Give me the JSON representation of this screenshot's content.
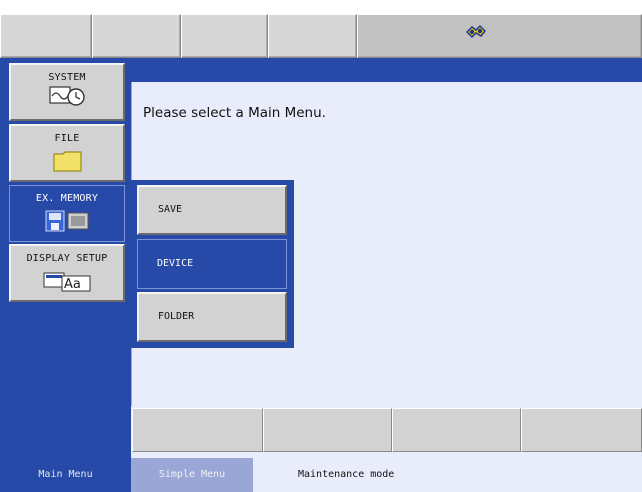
{
  "top_bar": {
    "status_icon": "robot-servo-icon"
  },
  "left_menu": {
    "items": [
      {
        "label": "SYSTEM",
        "icon": "system-clock-icon"
      },
      {
        "label": "FILE",
        "icon": "folder-icon"
      },
      {
        "label": "EX. MEMORY",
        "icon": "memory-device-icon"
      },
      {
        "label": "DISPLAY SETUP",
        "icon": "display-setup-icon"
      }
    ]
  },
  "main": {
    "message": "Please select a Main Menu."
  },
  "submenu": {
    "items": [
      {
        "label": "SAVE"
      },
      {
        "label": "DEVICE"
      },
      {
        "label": "FOLDER"
      }
    ]
  },
  "bottom_bar": {
    "main_menu": "Main Menu",
    "simple_menu": "Simple Menu",
    "mode": "Maintenance mode"
  },
  "colors": {
    "panel_blue": "#2749a8",
    "content_bg": "#e8ecfb",
    "button_gray": "#d2d2d2"
  }
}
